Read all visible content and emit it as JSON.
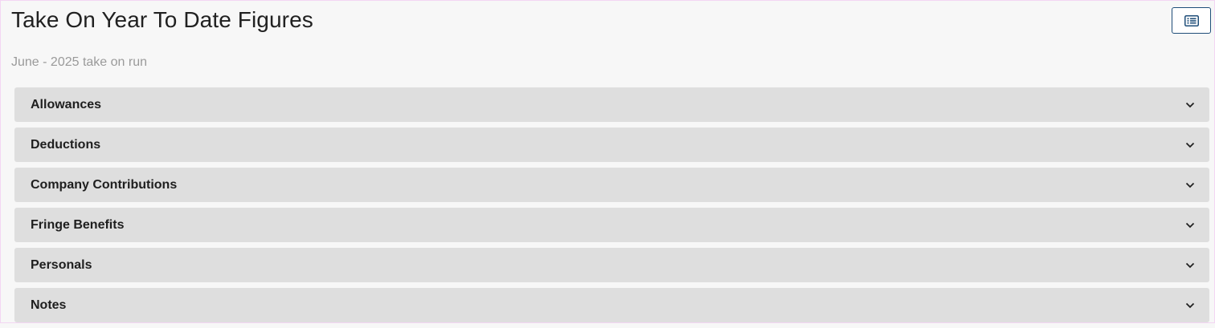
{
  "header": {
    "title": "Take On Year To Date Figures",
    "subtitle": "June - 2025 take on run",
    "list_button_icon": "list-icon"
  },
  "sections": [
    {
      "label": "Allowances",
      "icon": "chevron-down-icon"
    },
    {
      "label": "Deductions",
      "icon": "chevron-down-icon"
    },
    {
      "label": "Company Contributions",
      "icon": "chevron-down-icon"
    },
    {
      "label": "Fringe Benefits",
      "icon": "chevron-down-icon"
    },
    {
      "label": "Personals",
      "icon": "chevron-down-icon"
    },
    {
      "label": "Notes",
      "icon": "chevron-down-icon"
    }
  ],
  "colors": {
    "accent": "#1f4e79",
    "section_bg": "#dedede",
    "page_bg": "#f7f7f7"
  }
}
